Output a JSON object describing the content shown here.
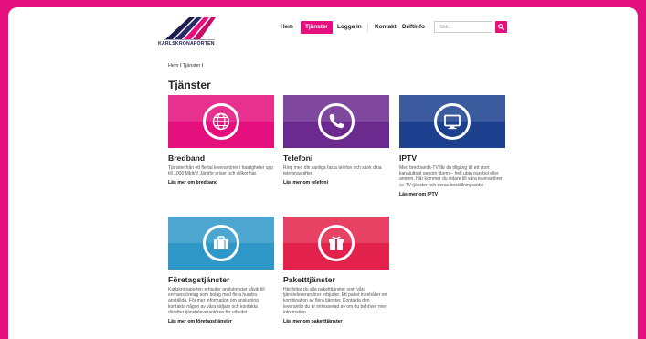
{
  "colors": {
    "brand": "#e5107d",
    "bredband": "#e5107d",
    "telefoni": "#6b2a8e",
    "iptv": "#1c3f8e",
    "foretag": "#2f98c8",
    "paket": "#e3224b"
  },
  "logo": {
    "text": "KARLSKRONAPORTEN"
  },
  "nav": {
    "items": [
      {
        "label": "Hem"
      },
      {
        "label": "Tjänster"
      },
      {
        "label": "Logga in"
      },
      {
        "label": "Kontakt"
      },
      {
        "label": "Driftinfo"
      }
    ]
  },
  "search": {
    "placeholder": "Sök.."
  },
  "breadcrumb": {
    "home": "Hem",
    "sep": "/",
    "current": "Tjänster",
    "end": "/"
  },
  "page": {
    "title": "Tjänster"
  },
  "cards": [
    {
      "icon": "globe-icon",
      "title": "Bredband",
      "desc": "Tjänster från ett flertal leverantörer i hastigheter upp till 1000 Mbit/s! Jämför priser och villkor här.",
      "link": "Läs mer om bredband"
    },
    {
      "icon": "phone-icon",
      "title": "Telefoni",
      "desc": "Ring med din vanliga fasta telefon och sänk dina telefonavgifter.",
      "link": "Läs mer om telefoni"
    },
    {
      "icon": "tv-icon",
      "title": "IPTV",
      "desc": "Med bredbands-TV får du tillgång till ett stort kanalutbud genom fibern – helt utan parabol eller antenn. Här kommer du vidare till våra leverantörer av TV-tjänster och deras beställningssidor.",
      "link": "Läs mer om IPTV"
    },
    {
      "icon": "briefcase-icon",
      "title": "Företagstjänster",
      "desc": "Karlskronaporten erbjuder anslutningar såväl till enmansföretag som bolag med flera hundra anställda. För mer information om anslutning kontakta någon av våra säljare och kontakta därefter tjänsteleverantören för utbudet.",
      "link": "Läs mer om företagstjänster"
    },
    {
      "icon": "gift-icon",
      "title": "Paketttjänster",
      "desc": "Här hittar du alla paketttjänster som våra tjänsteleverantörer erbjuder. Ett paket innehåller en kombination av flera tjänster. Kontakta den leverantör du är intresserad av om du behöver mer information.",
      "link": "Läs mer om paketttjänster"
    }
  ]
}
